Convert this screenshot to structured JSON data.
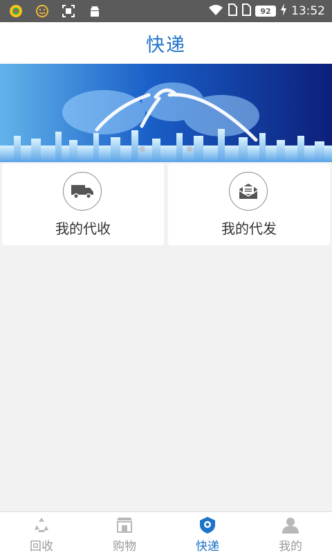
{
  "status_bar": {
    "battery": "92",
    "time": "13:52",
    "icons": [
      "app-icon",
      "smiley-icon",
      "screenshot-icon",
      "android-icon",
      "wifi-icon",
      "sim1-icon",
      "sim2-icon",
      "battery-icon",
      "charging-icon"
    ]
  },
  "header": {
    "title": "快递"
  },
  "banner": {
    "dots": 2
  },
  "cards": [
    {
      "label": "我的代收",
      "icon": "truck-icon"
    },
    {
      "label": "我的代发",
      "icon": "mail-icon"
    }
  ],
  "bottom_nav": {
    "items": [
      {
        "label": "回收",
        "icon": "recycle-icon"
      },
      {
        "label": "购物",
        "icon": "shop-icon"
      },
      {
        "label": "快递",
        "icon": "express-icon"
      },
      {
        "label": "我的",
        "icon": "profile-icon"
      }
    ],
    "active_index": 2
  },
  "colors": {
    "accent": "#1e73c8",
    "status_bar": "#5b5b5b",
    "background": "#f2f2f2",
    "inactive": "#9a9a9a"
  }
}
